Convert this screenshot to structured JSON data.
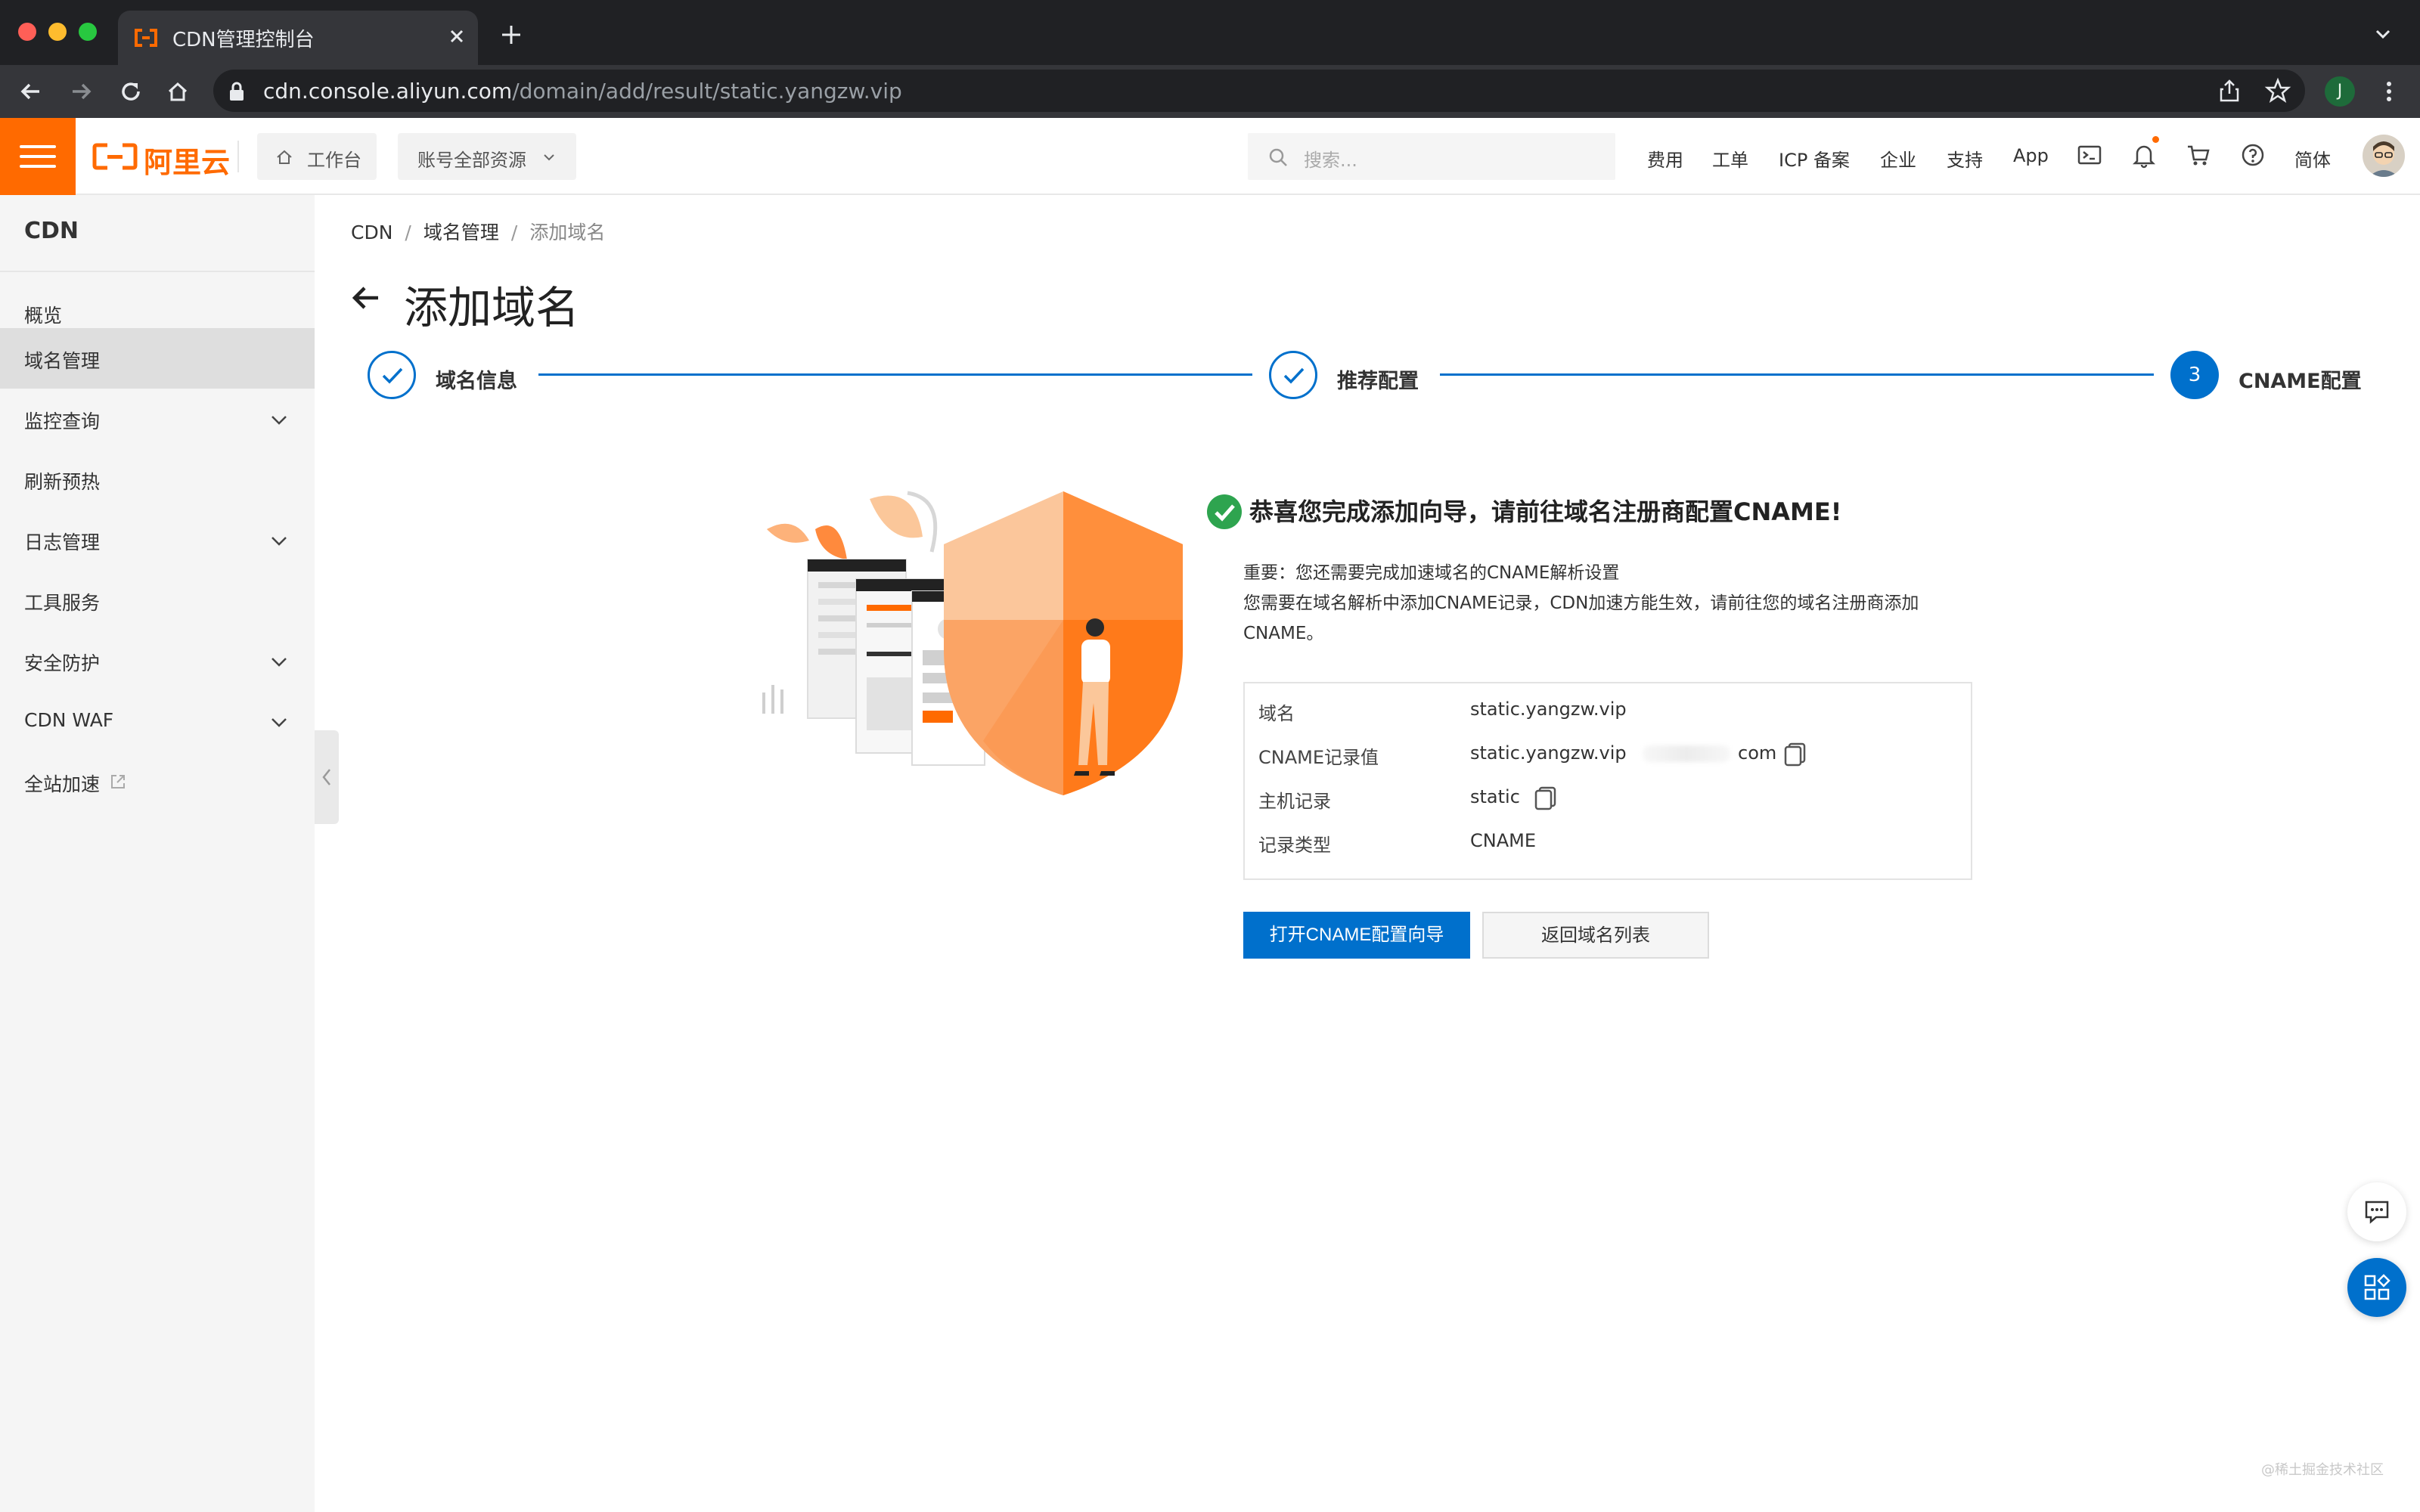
{
  "browser": {
    "tab_title": "CDN管理控制台",
    "url_host": "cdn.console.aliyun.com",
    "url_path": "/domain/add/result/static.yangzw.vip",
    "profile_initial": "J"
  },
  "topbar": {
    "logo_text": "阿里云",
    "workbench_label": "工作台",
    "resource_label": "账号全部资源",
    "search_placeholder": "搜索...",
    "links": [
      "费用",
      "工单",
      "ICP 备案",
      "企业",
      "支持",
      "App"
    ],
    "lang": "简体"
  },
  "sidebar": {
    "title": "CDN",
    "items": [
      {
        "label": "概览"
      },
      {
        "label": "域名管理"
      },
      {
        "label": "监控查询"
      },
      {
        "label": "刷新预热"
      },
      {
        "label": "日志管理"
      },
      {
        "label": "工具服务"
      },
      {
        "label": "安全防护"
      },
      {
        "label": "CDN WAF"
      },
      {
        "label": "全站加速"
      }
    ]
  },
  "breadcrumb": {
    "items": [
      "CDN",
      "域名管理"
    ],
    "current": "添加域名"
  },
  "page_title": "添加域名",
  "steps": [
    {
      "label": "域名信息",
      "status": "done"
    },
    {
      "label": "推荐配置",
      "status": "done"
    },
    {
      "number": "3",
      "label": "CNAME配置",
      "status": "current"
    }
  ],
  "result": {
    "title": "恭喜您完成添加向导，请前往域名注册商配置CNAME!",
    "desc_line1": "重要：您还需要完成加速域名的CNAME解析设置",
    "desc_line2": "您需要在域名解析中添加CNAME记录，CDN加速方能生效，请前往您的域名注册商添加",
    "desc_line3": "CNAME。",
    "rows": [
      {
        "key": "域名",
        "value": "static.yangzw.vip"
      },
      {
        "key": "CNAME记录值",
        "value": "static.yangzw.vip",
        "value_suffix": "com"
      },
      {
        "key": "主机记录",
        "value": "static"
      },
      {
        "key": "记录类型",
        "value": "CNAME"
      }
    ],
    "primary_button": "打开CNAME配置向导",
    "secondary_button": "返回域名列表"
  },
  "watermark": "@稀土掘金技术社区",
  "colors": {
    "brand": "#ff6a00",
    "primary": "#0070cc",
    "success": "#2ea44f"
  }
}
